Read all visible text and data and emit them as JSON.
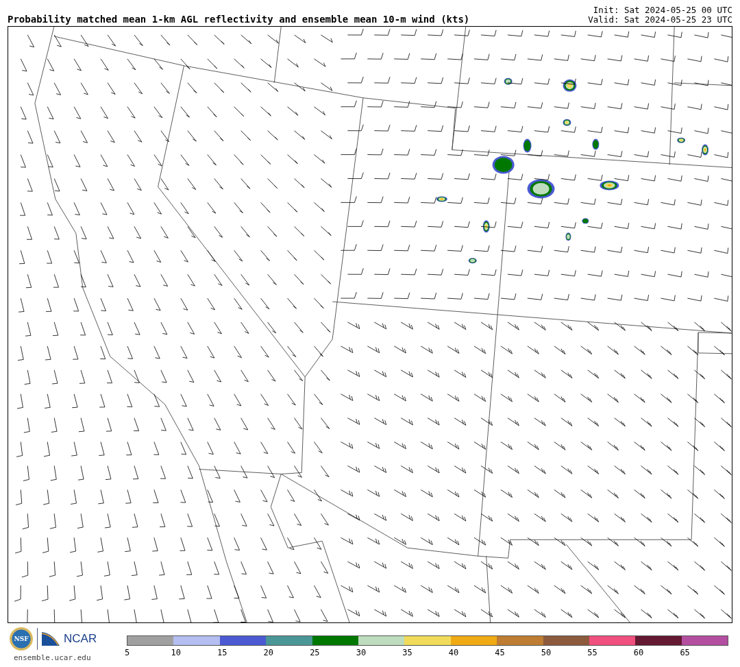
{
  "title": "Probability matched mean 1-km AGL reflectivity and ensemble mean 10-m wind (kts)",
  "times": [
    "Init: Sat 2024-05-25 00 UTC",
    "Valid: Sat 2024-05-25 23 UTC"
  ],
  "logos": {
    "seal_text": "NSF",
    "wordmark": "NCAR",
    "site": "ensemble.ucar.edu"
  },
  "colorbar": {
    "segments": [
      {
        "color": "#a0a0a0"
      },
      {
        "color": "#b4bef0"
      },
      {
        "color": "#4b5ad2"
      },
      {
        "color": "#4b9696"
      },
      {
        "color": "#007800"
      },
      {
        "color": "#bedcbe"
      },
      {
        "color": "#f0dc5a"
      },
      {
        "color": "#f0aa14"
      },
      {
        "color": "#be7d32"
      },
      {
        "color": "#8c5a3c"
      },
      {
        "color": "#f0507e"
      },
      {
        "color": "#641832"
      },
      {
        "color": "#b44ea0"
      }
    ],
    "ticks": [
      "5",
      "10",
      "15",
      "20",
      "25",
      "30",
      "35",
      "40",
      "45",
      "50",
      "55",
      "60",
      "65"
    ]
  }
}
